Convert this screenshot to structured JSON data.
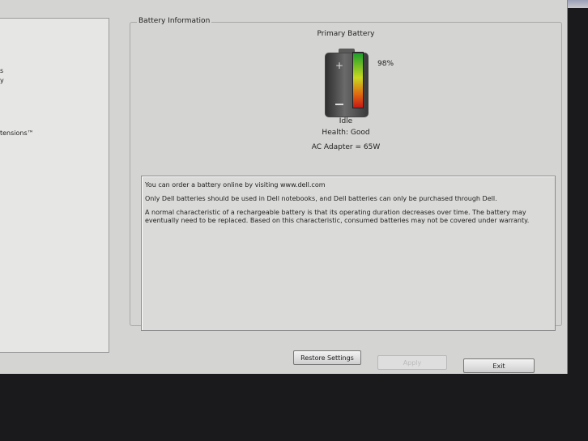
{
  "left_panel": {
    "items": [
      "s",
      "y",
      "tensions™"
    ]
  },
  "battery_info": {
    "group_title": "Battery Information",
    "heading": "Primary Battery",
    "charge_percent": 98,
    "charge_label": "98%",
    "status": "Idle",
    "health": "Health: Good",
    "ac_adapter": "AC Adapter = 65W",
    "gauge_colors": [
      "#1ea02a",
      "#c8d820",
      "#e06a10",
      "#c81818"
    ]
  },
  "info_text": {
    "line1": "You can order a battery online by visiting www.dell.com",
    "line2": "Only Dell batteries should be used in Dell notebooks, and Dell batteries can only be purchased through Dell.",
    "line3": "A normal characteristic of a rechargeable battery is that its operating duration decreases over time.  The battery may eventually need to be replaced.  Based on this characteristic, consumed batteries may not be covered under warranty."
  },
  "buttons": {
    "restore": "Restore Settings",
    "apply": "Apply",
    "exit": "Exit"
  }
}
